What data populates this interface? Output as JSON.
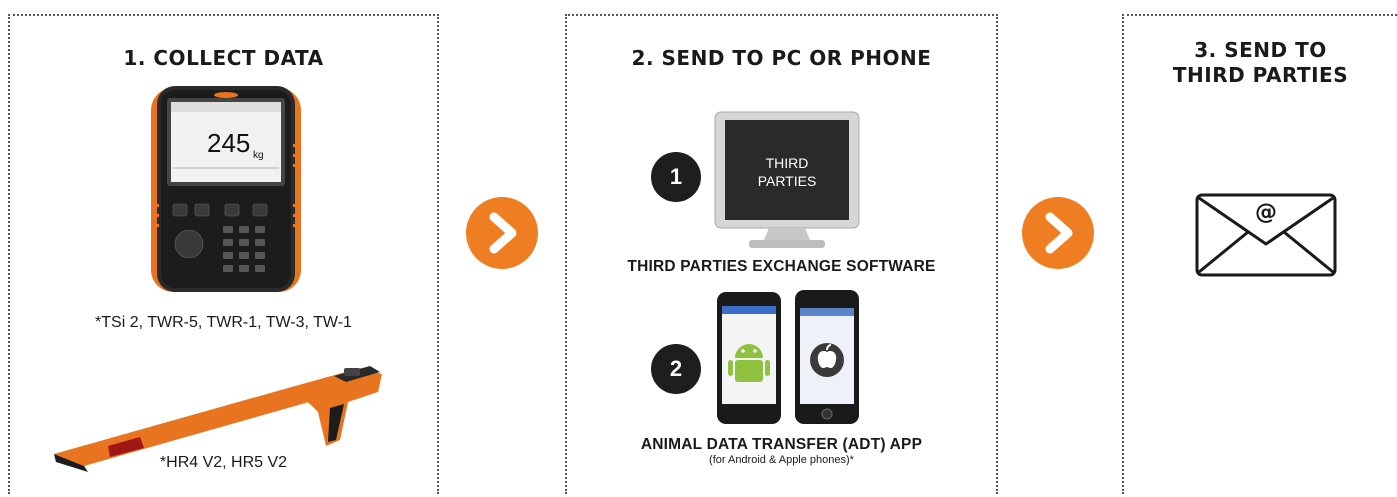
{
  "steps": [
    {
      "title": "1. COLLECT DATA",
      "devices": [
        {
          "caption": "*TSi 2, TWR-5, TWR-1, TW-3, TW-1",
          "screen_value": "245",
          "screen_unit": "kg"
        },
        {
          "caption": "*HR4 V2, HR5 V2"
        }
      ]
    },
    {
      "title": "2. SEND TO PC OR PHONE",
      "options": [
        {
          "number": "1",
          "monitor_text_line1": "THIRD",
          "monitor_text_line2": "PARTIES",
          "caption": "THIRD PARTIES EXCHANGE SOFTWARE"
        },
        {
          "number": "2",
          "caption": "ANIMAL DATA TRANSFER (ADT) APP",
          "subcaption": "(for Android & Apple phones)*"
        }
      ]
    },
    {
      "title_line1": "3. SEND TO",
      "title_line2": "THIRD PARTIES",
      "email_symbol": "@"
    }
  ],
  "colors": {
    "accent": "#ef7d22",
    "dark": "#1e1e1e",
    "border": "#555555"
  },
  "icons": [
    "next-arrow-icon",
    "email-envelope-icon",
    "android-icon",
    "apple-icon"
  ]
}
